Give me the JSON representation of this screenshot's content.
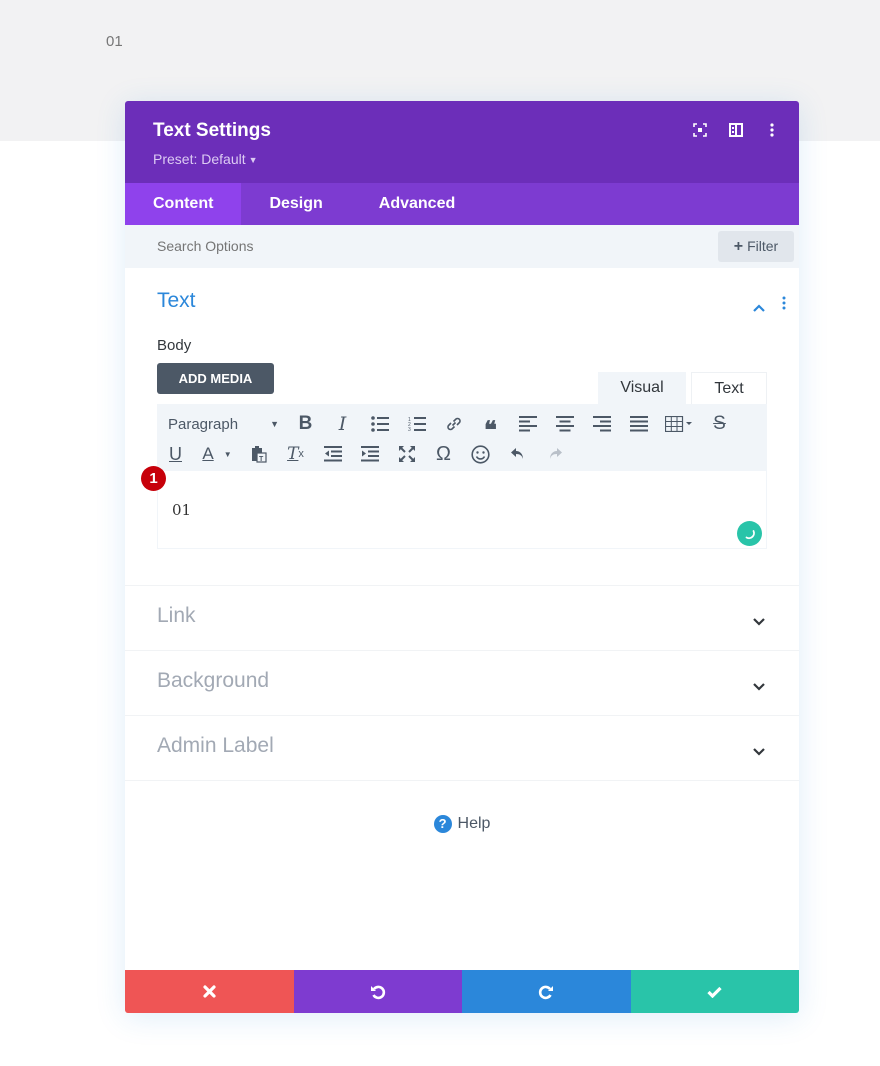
{
  "page": {
    "background_text": "01"
  },
  "modal": {
    "title": "Text Settings",
    "preset_label": "Preset: Default",
    "header_icons": [
      "focus-icon",
      "split-view-icon",
      "more-options-icon"
    ],
    "tabs": [
      {
        "label": "Content",
        "active": true
      },
      {
        "label": "Design",
        "active": false
      },
      {
        "label": "Advanced",
        "active": false
      }
    ],
    "search": {
      "placeholder": "Search Options",
      "filter_label": "Filter"
    },
    "sections": {
      "text": {
        "title": "Text",
        "body_label": "Body",
        "add_media_label": "ADD MEDIA",
        "editor_tabs": [
          "Visual",
          "Text"
        ],
        "paragraph_select": "Paragraph",
        "editor_content": "01",
        "badge": "1"
      },
      "collapsed": [
        {
          "title": "Link"
        },
        {
          "title": "Background"
        },
        {
          "title": "Admin Label"
        }
      ]
    },
    "help_label": "Help",
    "help_icon": "?",
    "colors": {
      "header": "#6c2eb9",
      "tabs": "#7d3bd1",
      "active_tab": "#8f42ec",
      "cancel": "#ef5555",
      "undo": "#7e3bd0",
      "redo": "#2b87da",
      "save": "#29c4a9",
      "section_title_active": "#2b87da"
    }
  }
}
